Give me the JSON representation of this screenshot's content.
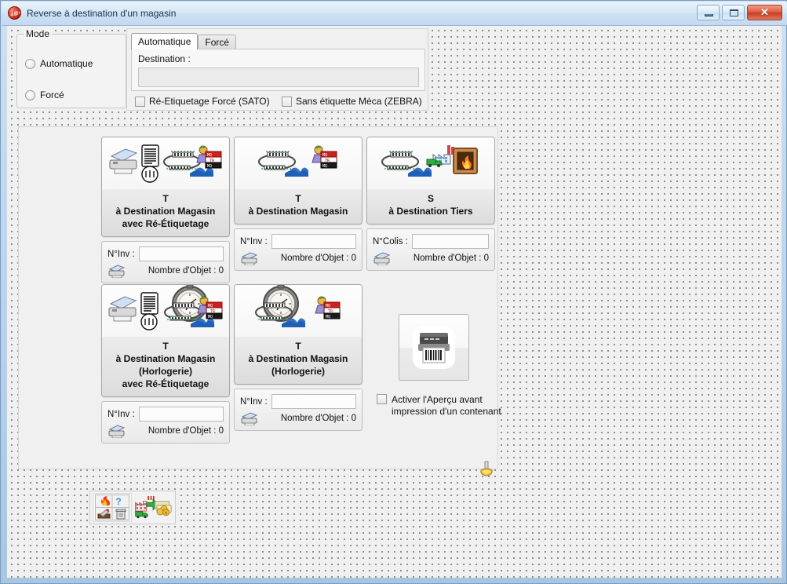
{
  "window": {
    "title": "Reverse à destination d'un magasin",
    "app_icon": "app-logo-icon",
    "buttons": {
      "minimize": "minimize-icon",
      "maximize": "maximize-icon",
      "close": "✕"
    }
  },
  "mode_group": {
    "legend": "Mode",
    "options": [
      {
        "label": "Automatique",
        "selected": false
      },
      {
        "label": "Forcé",
        "selected": false
      }
    ]
  },
  "tabs_panel": {
    "tabs": [
      {
        "label": "Automatique",
        "active": true
      },
      {
        "label": "Forcé",
        "active": false
      }
    ],
    "destination": {
      "label": "Destination :",
      "value": "",
      "placeholder": ""
    },
    "checkboxes": [
      {
        "label": "Ré-Etiquetage Forcé (SATO)",
        "checked": false
      },
      {
        "label": "Sans étiquette Méca (ZEBRA)",
        "checked": false
      }
    ]
  },
  "cards": [
    {
      "id": "card-magasin-reetiquetage",
      "icons": [
        "printer-icon",
        "document-meter-icon",
        "conveyor-wave-icon",
        "label-worker-icon"
      ],
      "caption_lines": [
        "T",
        "à Destination Magasin",
        "avec Ré-Étiquetage"
      ],
      "field_label": "N°Inv :",
      "field_value": "",
      "count_label": "Nombre d'Objet : 0",
      "sub_icon": "printer-icon"
    },
    {
      "id": "card-magasin",
      "icons": [
        "conveyor-wave-icon",
        "label-worker-icon"
      ],
      "caption_lines": [
        "T",
        "à Destination Magasin"
      ],
      "field_label": "N°Inv :",
      "field_value": "",
      "count_label": "Nombre d'Objet : 0",
      "sub_icon": "printer-icon"
    },
    {
      "id": "card-tiers",
      "icons": [
        "conveyor-wave-icon",
        "factory-truck-icon",
        "furnace-fire-icon"
      ],
      "caption_lines": [
        "S",
        "à Destination Tiers"
      ],
      "field_label": "N°Colis :",
      "field_value": "",
      "count_label": "Nombre d'Objet : 0",
      "sub_icon": "printer-icon"
    },
    {
      "id": "card-horlogerie-reetiquetage",
      "icons": [
        "printer-icon",
        "document-meter-icon",
        "watch-conveyor-icon",
        "label-worker-icon"
      ],
      "caption_lines": [
        "T",
        "à Destination Magasin",
        "(Horlogerie)",
        "avec Ré-Étiquetage"
      ],
      "field_label": "N°Inv :",
      "field_value": "",
      "count_label": "Nombre d'Objet : 0",
      "sub_icon": "printer-icon"
    },
    {
      "id": "card-horlogerie",
      "icons": [
        "watch-conveyor-icon",
        "label-worker-icon"
      ],
      "caption_lines": [
        "T",
        "à Destination Magasin",
        "(Horlogerie)"
      ],
      "field_label": "N°Inv :",
      "field_value": "",
      "count_label": "Nombre d'Objet : 0",
      "sub_icon": "printer-icon"
    }
  ],
  "printer_section": {
    "button_icon": "barcode-printer-icon",
    "hand_icon": "hand-pointer-icon",
    "preview_checkbox": {
      "label_line1": "Activer l'Aperçu avant",
      "label_line2": "impression d'un contenant",
      "checked": false
    }
  },
  "toolbar": {
    "buttons": [
      {
        "id": "tb-grid-button",
        "icon": "fire-help-tool-trash-icon"
      },
      {
        "id": "tb-invoice-button",
        "icon": "factory-truck-money-icon"
      }
    ]
  },
  "colors": {
    "titlebar_start": "#e9f2fa",
    "titlebar_end": "#c3d9ee",
    "close_button": "#c73e21",
    "client_bg": "#f0f0f0",
    "dot_color": "#6e6e6e",
    "card_border": "#a8a8a8"
  }
}
